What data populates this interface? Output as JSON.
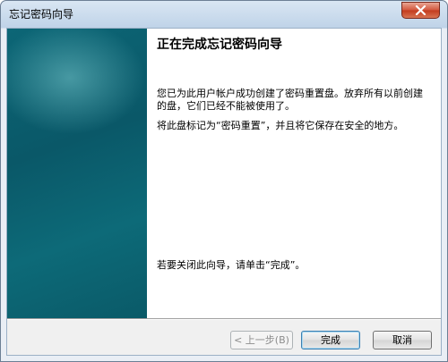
{
  "window": {
    "title": "忘记密码向导"
  },
  "content": {
    "heading": "正在完成忘记密码向导",
    "paragraph1": "您已为此用户帐户成功创建了密码重置盘。放弃所有以前创建的盘，它们已经不能被使用了。",
    "paragraph2": "将此盘标记为“密码重置”，并且将它保存在安全的地方。",
    "paragraph3": "若要关闭此向导，请单击“完成”。"
  },
  "buttons": {
    "back": "< 上一步(B)",
    "finish": "完成",
    "cancel": "取消"
  },
  "colors": {
    "side_panel": "#0a5868",
    "close_button": "#c23a1d"
  },
  "icons": {
    "close": "close-icon"
  }
}
